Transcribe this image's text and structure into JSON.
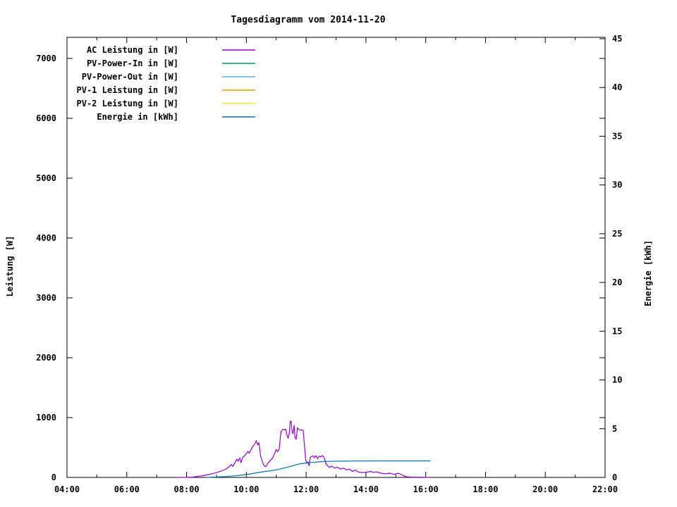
{
  "title": "Tagesdiagramm vom 2014-11-20",
  "axes": {
    "x": {
      "major_tick_hours": [
        4,
        6,
        8,
        10,
        12,
        14,
        16,
        18,
        20,
        22
      ],
      "major_tick_labels": [
        "04:00",
        "06:00",
        "08:00",
        "10:00",
        "12:00",
        "14:00",
        "16:00",
        "18:00",
        "20:00",
        "22:00"
      ],
      "minor_tick_hours": [
        5,
        7,
        9,
        11,
        13,
        15,
        17,
        19,
        21
      ]
    },
    "left": {
      "label": "Leistung [W]",
      "ticks": [
        0,
        1000,
        2000,
        3000,
        4000,
        5000,
        6000,
        7000
      ],
      "range": [
        0,
        7350
      ]
    },
    "right": {
      "label": "Energie [kWh]",
      "ticks": [
        0,
        5,
        10,
        15,
        20,
        25,
        30,
        35,
        40,
        45
      ],
      "range": [
        0,
        45.2
      ]
    }
  },
  "chart_data": {
    "type": "line",
    "title": "Tagesdiagramm vom 2014-11-20",
    "xlabel": "",
    "x_unit": "time of day (hours)",
    "x_range_hours": [
      4,
      22
    ],
    "ylabel_left": "Leistung [W]",
    "ylim_left": [
      0,
      7350
    ],
    "ylabel_right": "Energie [kWh]",
    "ylim_right": [
      0,
      45.2
    ],
    "grid": false,
    "legend_position": "top-left-inside",
    "series": [
      {
        "name": "AC Leistung in [W]",
        "color": "#9400D3",
        "axis": "left",
        "points": [
          [
            7.7,
            0
          ],
          [
            8.0,
            2
          ],
          [
            8.2,
            5
          ],
          [
            8.35,
            15
          ],
          [
            8.5,
            25
          ],
          [
            8.65,
            40
          ],
          [
            8.8,
            55
          ],
          [
            9.0,
            80
          ],
          [
            9.15,
            105
          ],
          [
            9.3,
            135
          ],
          [
            9.42,
            175
          ],
          [
            9.5,
            215
          ],
          [
            9.55,
            185
          ],
          [
            9.62,
            250
          ],
          [
            9.68,
            305
          ],
          [
            9.72,
            270
          ],
          [
            9.78,
            325
          ],
          [
            9.82,
            245
          ],
          [
            9.88,
            335
          ],
          [
            9.95,
            365
          ],
          [
            10.0,
            395
          ],
          [
            10.05,
            435
          ],
          [
            10.1,
            405
          ],
          [
            10.15,
            460
          ],
          [
            10.2,
            505
          ],
          [
            10.27,
            550
          ],
          [
            10.33,
            615
          ],
          [
            10.38,
            545
          ],
          [
            10.42,
            580
          ],
          [
            10.47,
            375
          ],
          [
            10.52,
            285
          ],
          [
            10.58,
            205
          ],
          [
            10.65,
            180
          ],
          [
            10.72,
            235
          ],
          [
            10.8,
            285
          ],
          [
            10.88,
            325
          ],
          [
            10.95,
            405
          ],
          [
            11.0,
            465
          ],
          [
            11.05,
            430
          ],
          [
            11.1,
            475
          ],
          [
            11.13,
            625
          ],
          [
            11.16,
            765
          ],
          [
            11.2,
            790
          ],
          [
            11.24,
            805
          ],
          [
            11.28,
            795
          ],
          [
            11.32,
            805
          ],
          [
            11.36,
            700
          ],
          [
            11.4,
            655
          ],
          [
            11.44,
            750
          ],
          [
            11.47,
            940
          ],
          [
            11.5,
            935
          ],
          [
            11.53,
            765
          ],
          [
            11.56,
            730
          ],
          [
            11.6,
            870
          ],
          [
            11.63,
            655
          ],
          [
            11.67,
            640
          ],
          [
            11.71,
            830
          ],
          [
            11.76,
            800
          ],
          [
            11.8,
            790
          ],
          [
            11.85,
            795
          ],
          [
            11.9,
            785
          ],
          [
            11.94,
            560
          ],
          [
            11.98,
            305
          ],
          [
            12.02,
            235
          ],
          [
            12.06,
            260
          ],
          [
            12.1,
            195
          ],
          [
            12.14,
            335
          ],
          [
            12.18,
            350
          ],
          [
            12.24,
            360
          ],
          [
            12.28,
            330
          ],
          [
            12.33,
            365
          ],
          [
            12.38,
            315
          ],
          [
            12.44,
            355
          ],
          [
            12.5,
            345
          ],
          [
            12.55,
            365
          ],
          [
            12.6,
            335
          ],
          [
            12.65,
            245
          ],
          [
            12.7,
            205
          ],
          [
            12.78,
            165
          ],
          [
            12.85,
            190
          ],
          [
            12.95,
            155
          ],
          [
            13.05,
            170
          ],
          [
            13.15,
            140
          ],
          [
            13.25,
            155
          ],
          [
            13.35,
            125
          ],
          [
            13.45,
            140
          ],
          [
            13.55,
            100
          ],
          [
            13.65,
            125
          ],
          [
            13.75,
            90
          ],
          [
            13.9,
            80
          ],
          [
            14.05,
            90
          ],
          [
            14.15,
            100
          ],
          [
            14.25,
            85
          ],
          [
            14.35,
            95
          ],
          [
            14.5,
            70
          ],
          [
            14.65,
            60
          ],
          [
            14.8,
            70
          ],
          [
            14.95,
            50
          ],
          [
            15.05,
            70
          ],
          [
            15.15,
            60
          ],
          [
            15.25,
            30
          ],
          [
            15.35,
            12
          ],
          [
            15.5,
            6
          ],
          [
            15.7,
            4
          ],
          [
            15.9,
            3
          ],
          [
            16.08,
            0
          ]
        ]
      },
      {
        "name": "PV-Power-In in [W]",
        "color": "#009E73",
        "axis": "left",
        "points": []
      },
      {
        "name": "PV-Power-Out in [W]",
        "color": "#56B4E9",
        "axis": "left",
        "points": []
      },
      {
        "name": "PV-1 Leistung in [W]",
        "color": "#E69F00",
        "axis": "left",
        "points": []
      },
      {
        "name": "PV-2 Leistung in [W]",
        "color": "#F0E442",
        "axis": "left",
        "points": []
      },
      {
        "name": "Energie in [kWh]",
        "color": "#0072B2",
        "axis": "right",
        "points": [
          [
            8.7,
            0
          ],
          [
            9.0,
            0.04
          ],
          [
            9.3,
            0.09
          ],
          [
            9.6,
            0.16
          ],
          [
            9.9,
            0.26
          ],
          [
            10.2,
            0.4
          ],
          [
            10.5,
            0.55
          ],
          [
            10.8,
            0.68
          ],
          [
            11.0,
            0.78
          ],
          [
            11.2,
            0.92
          ],
          [
            11.4,
            1.07
          ],
          [
            11.6,
            1.24
          ],
          [
            11.8,
            1.4
          ],
          [
            12.0,
            1.48
          ],
          [
            12.2,
            1.54
          ],
          [
            12.4,
            1.59
          ],
          [
            12.6,
            1.63
          ],
          [
            12.8,
            1.65
          ],
          [
            13.0,
            1.66
          ],
          [
            13.3,
            1.67
          ],
          [
            13.6,
            1.68
          ],
          [
            14.0,
            1.69
          ],
          [
            14.5,
            1.7
          ],
          [
            15.0,
            1.7
          ],
          [
            15.5,
            1.7
          ],
          [
            16.15,
            1.7
          ]
        ]
      }
    ]
  }
}
